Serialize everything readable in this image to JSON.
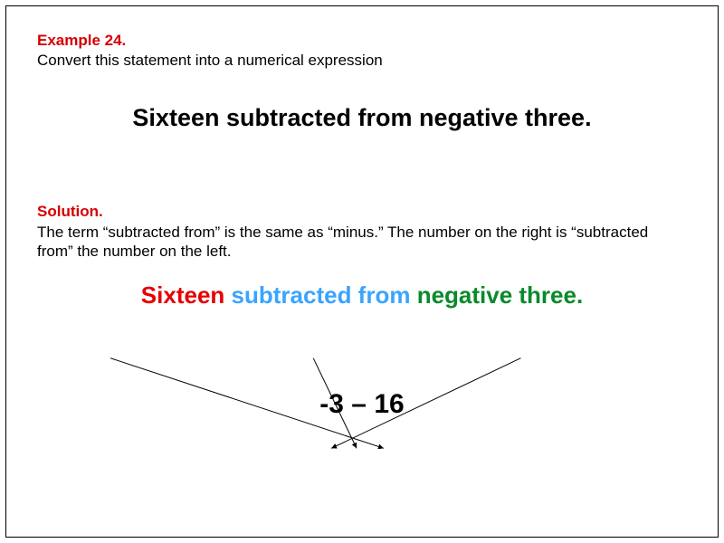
{
  "example": {
    "label": "Example 24.",
    "instruction": "Convert this statement into a numerical expression"
  },
  "statement": "Sixteen subtracted from negative three.",
  "solution": {
    "label": "Solution.",
    "explanation": "The term “subtracted from” is the same as “minus.” The number on the right is “subtracted from” the number on the left."
  },
  "colored": {
    "part1": "Sixteen",
    "part2": "subtracted from",
    "part3": "negative three."
  },
  "result": "-3 – 16",
  "colors": {
    "red": "#e60000",
    "blue": "#3aa4ff",
    "green": "#0a8a2a",
    "label_red": "#d60000"
  }
}
